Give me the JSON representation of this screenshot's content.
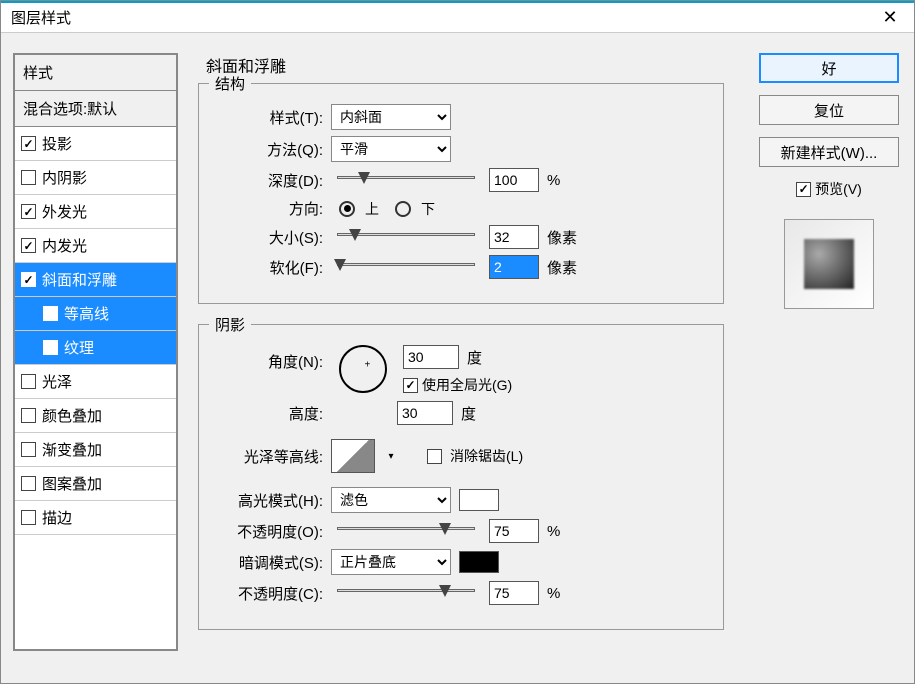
{
  "window": {
    "title": "图层样式"
  },
  "sidebar": {
    "header": "样式",
    "subheader": "混合选项:默认",
    "items": [
      {
        "label": "投影",
        "checked": true,
        "selected": false,
        "level": 0
      },
      {
        "label": "内阴影",
        "checked": false,
        "selected": false,
        "level": 0
      },
      {
        "label": "外发光",
        "checked": true,
        "selected": false,
        "level": 0
      },
      {
        "label": "内发光",
        "checked": true,
        "selected": false,
        "level": 0
      },
      {
        "label": "斜面和浮雕",
        "checked": true,
        "selected": true,
        "level": 0
      },
      {
        "label": "等高线",
        "checked": false,
        "selected": true,
        "level": 1
      },
      {
        "label": "纹理",
        "checked": false,
        "selected": true,
        "level": 1
      },
      {
        "label": "光泽",
        "checked": false,
        "selected": false,
        "level": 0
      },
      {
        "label": "颜色叠加",
        "checked": false,
        "selected": false,
        "level": 0
      },
      {
        "label": "渐变叠加",
        "checked": false,
        "selected": false,
        "level": 0
      },
      {
        "label": "图案叠加",
        "checked": false,
        "selected": false,
        "level": 0
      },
      {
        "label": "描边",
        "checked": false,
        "selected": false,
        "level": 0
      }
    ]
  },
  "panel": {
    "title": "斜面和浮雕",
    "structure": {
      "group_label": "结构",
      "style_label": "样式(T):",
      "style_value": "内斜面",
      "method_label": "方法(Q):",
      "method_value": "平滑",
      "depth_label": "深度(D):",
      "depth_value": "100",
      "depth_unit": "%",
      "direction_label": "方向:",
      "up": "上",
      "down": "下",
      "dir_value": "up",
      "size_label": "大小(S):",
      "size_value": "32",
      "size_unit": "像素",
      "soften_label": "软化(F):",
      "soften_value": "2",
      "soften_unit": "像素"
    },
    "shade": {
      "group_label": "阴影",
      "angle_label": "角度(N):",
      "angle_value": "30",
      "angle_unit": "度",
      "global_label": "使用全局光(G)",
      "global_checked": true,
      "altitude_label": "高度:",
      "altitude_value": "30",
      "altitude_unit": "度",
      "contour_label": "光泽等高线:",
      "antialias_label": "消除锯齿(L)",
      "antialias_checked": false,
      "highlight_label": "高光模式(H):",
      "highlight_value": "滤色",
      "highlight_color": "#ffffff",
      "highlight_opacity_label": "不透明度(O):",
      "highlight_opacity": "75",
      "hop_unit": "%",
      "shadow_label": "暗调模式(S):",
      "shadow_value": "正片叠底",
      "shadow_color": "#000000",
      "shadow_opacity_label": "不透明度(C):",
      "shadow_opacity": "75",
      "sop_unit": "%"
    }
  },
  "buttons": {
    "ok": "好",
    "reset": "复位",
    "new_style": "新建样式(W)...",
    "preview_label": "预览(V)",
    "preview_checked": true
  }
}
